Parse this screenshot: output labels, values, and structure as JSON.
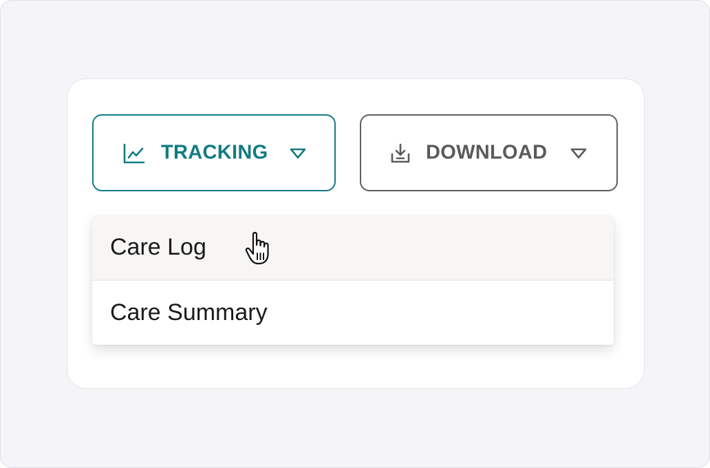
{
  "toolbar": {
    "tracking": {
      "label": "TRACKING",
      "icon": "line-chart-icon",
      "caret_icon": "caret-down-icon",
      "color": "#127c82",
      "expanded": true
    },
    "download": {
      "label": "DOWNLOAD",
      "icon": "download-icon",
      "caret_icon": "caret-down-icon",
      "color": "#5a5a5a"
    }
  },
  "tracking_menu": {
    "items": [
      {
        "label": "Care Log",
        "hovered": true
      },
      {
        "label": "Care Summary",
        "hovered": false
      }
    ]
  },
  "cursor": {
    "icon": "pointer-hand-icon"
  }
}
